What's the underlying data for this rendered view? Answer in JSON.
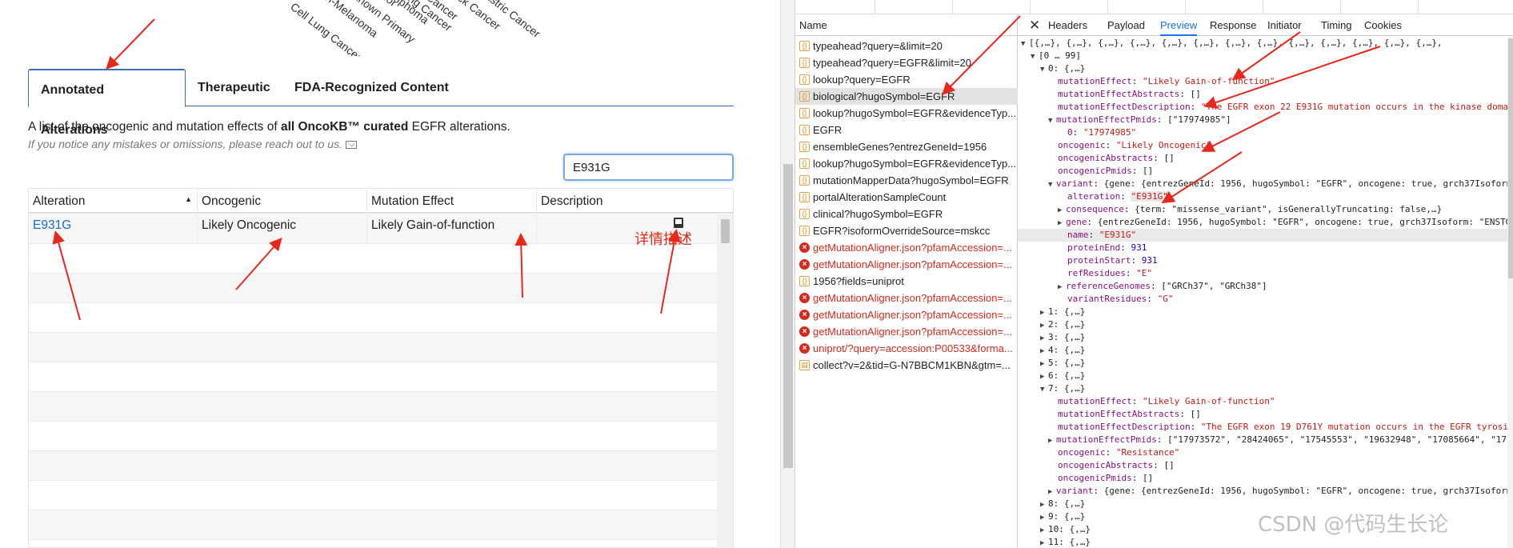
{
  "left": {
    "rotated_labels": [
      "Cell Lung Cancer",
      "Non-Melanoma",
      "Unknown Primary",
      "Tumor",
      "Lymphoma",
      "Lung Cancer",
      "Cancer",
      "Neck Cancer",
      "Gastric Cancer"
    ],
    "tabs": [
      {
        "label": "Annotated Alterations",
        "active": true
      },
      {
        "label": "Therapeutic",
        "active": false
      },
      {
        "label": "FDA-Recognized Content",
        "active": false
      }
    ],
    "description_prefix": "A list of the oncogenic and mutation effects of ",
    "description_bold": "all OncoKB™ curated",
    "description_suffix": " EGFR alterations.",
    "notice": "If you notice any mistakes or omissions, please reach out to us.",
    "search_value": "E931G",
    "table": {
      "headers": [
        "Alteration",
        "Oncogenic",
        "Mutation Effect",
        "Description"
      ],
      "rows": [
        {
          "alteration": "E931G",
          "oncogenic": "Likely Oncogenic",
          "mutation_effect": "Likely Gain-of-function"
        }
      ]
    },
    "annotation_text": "详情描述"
  },
  "devtools": {
    "name_header": "Name",
    "requests": [
      {
        "name": "typeahead?query=&limit=20",
        "type": "xhr",
        "error": false
      },
      {
        "name": "typeahead?query=EGFR&limit=20",
        "type": "xhr",
        "error": false
      },
      {
        "name": "lookup?query=EGFR",
        "type": "xhr",
        "error": false
      },
      {
        "name": "biological?hugoSymbol=EGFR",
        "type": "xhr",
        "error": false,
        "selected": true
      },
      {
        "name": "lookup?hugoSymbol=EGFR&evidenceTyp...",
        "type": "xhr",
        "error": false
      },
      {
        "name": "EGFR",
        "type": "xhr",
        "error": false
      },
      {
        "name": "ensembleGenes?entrezGeneId=1956",
        "type": "xhr",
        "error": false
      },
      {
        "name": "lookup?hugoSymbol=EGFR&evidenceTyp...",
        "type": "xhr",
        "error": false
      },
      {
        "name": "mutationMapperData?hugoSymbol=EGFR",
        "type": "xhr",
        "error": false
      },
      {
        "name": "portalAlterationSampleCount",
        "type": "xhr",
        "error": false
      },
      {
        "name": "clinical?hugoSymbol=EGFR",
        "type": "xhr",
        "error": false
      },
      {
        "name": "EGFR?isoformOverrideSource=mskcc",
        "type": "xhr",
        "error": false
      },
      {
        "name": "getMutationAligner.json?pfamAccession=...",
        "type": "err",
        "error": true
      },
      {
        "name": "getMutationAligner.json?pfamAccession=...",
        "type": "err",
        "error": true
      },
      {
        "name": "1956?fields=uniprot",
        "type": "xhr",
        "error": false
      },
      {
        "name": "getMutationAligner.json?pfamAccession=...",
        "type": "err",
        "error": true
      },
      {
        "name": "getMutationAligner.json?pfamAccession=...",
        "type": "err",
        "error": true
      },
      {
        "name": "getMutationAligner.json?pfamAccession=...",
        "type": "err",
        "error": true
      },
      {
        "name": "uniprot/?query=accession:P00533&forma...",
        "type": "err",
        "error": true
      },
      {
        "name": "collect?v=2&tid=G-N7BBCM1KBN&gtm=...",
        "type": "doc",
        "error": false
      }
    ],
    "detail_tabs": [
      "Headers",
      "Payload",
      "Preview",
      "Response",
      "Initiator",
      "Timing",
      "Cookies"
    ],
    "active_tab": "Preview",
    "preview": {
      "root": "[{,…}, {,…}, {,…}, {,…}, {,…}, {,…}, {,…}, {,…}, {,…}, {,…}, {,…}, {,…}, {,…},",
      "range": "[0 … 99]",
      "item0": "0: {,…}",
      "mutationEffect": "\"Likely Gain-of-function\"",
      "mutationEffectAbstracts": "[]",
      "mutationEffectDescription": "\"The EGFR exon 22 E931G mutation occurs in the kinase domain of t",
      "mutationEffectPmids": "[\"17974985\"]",
      "pmid0": "\"17974985\"",
      "oncogenic": "\"Likely Oncogenic\"",
      "oncogenicAbstracts": "[]",
      "oncogenicPmids": "[]",
      "variant": "{gene: {entrezGeneId: 1956, hugoSymbol: \"EGFR\", oncogene: true, grch37Isoform: \"ENS",
      "alteration": "\"E931G\"",
      "consequence": "{term: \"missense_variant\", isGenerallyTruncating: false,…}",
      "gene": "{entrezGeneId: 1956, hugoSymbol: \"EGFR\", oncogene: true, grch37Isoform: \"ENST0000027",
      "name": "\"E931G\"",
      "proteinEnd": "931",
      "proteinStart": "931",
      "refResidues": "\"E\"",
      "referenceGenomes": "[\"GRCh37\", \"GRCh38\"]",
      "variantResidues": "\"G\"",
      "collapsed_items": [
        "1: {,…}",
        "2: {,…}",
        "3: {,…}",
        "4: {,…}",
        "5: {,…}",
        "6: {,…}"
      ],
      "item7": "7: {,…}",
      "i7_mutationEffect": "\"Likely Gain-of-function\"",
      "i7_mutationEffectAbstracts": "[]",
      "i7_mutationEffectDescription": "\"The EGFR exon 19 D761Y mutation occurs in the EGFR tyrosine kina",
      "i7_mutationEffectPmids": "[\"17973572\", \"28424065\", \"17545553\", \"19632948\", \"17085664\", \"17192902\"",
      "i7_oncogenic": "\"Resistance\"",
      "i7_oncogenicAbstracts": "[]",
      "i7_oncogenicPmids": "[]",
      "i7_variant": "{gene: {entrezGeneId: 1956, hugoSymbol: \"EGFR\", oncogene: true, grch37Isoform: \"ENS",
      "tail_items": [
        "8: {,…}",
        "9: {,…}",
        "10: {,…}",
        "11: {,…}"
      ]
    }
  },
  "watermark": "CSDN @代码生长论"
}
